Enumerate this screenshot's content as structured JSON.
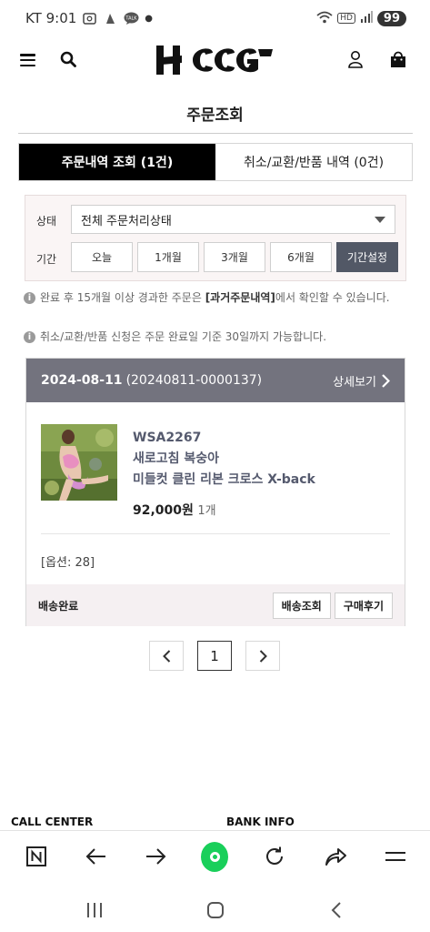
{
  "status_bar": {
    "carrier_time": "KT 9:01",
    "battery": "99",
    "network": "HD"
  },
  "header": {
    "logo_alt": "HOOG"
  },
  "page": {
    "title": "주문조회"
  },
  "tabs": [
    {
      "label": "주문내역 조회 (1건)",
      "active": true
    },
    {
      "label": "취소/교환/반품 내역 (0건)",
      "active": false
    }
  ],
  "filter": {
    "status_label": "상태",
    "status_value": "전체 주문처리상태",
    "period_label": "기간",
    "period_buttons": [
      "오늘",
      "1개월",
      "3개월",
      "6개월",
      "기간설정"
    ]
  },
  "notices": {
    "n1_pre": "완료 후 15개월 이상 경과한 주문은 ",
    "n1_bold": "[과거주문내역]",
    "n1_post": "에서 확인할 수 있습니다.",
    "n2": "취소/교환/반품 신청은 주문 완료일 기준 30일까지 가능합니다."
  },
  "order": {
    "date": "2024-08-11",
    "number": "(20240811-0000137)",
    "detail_label": "상세보기",
    "product_code": "WSA2267",
    "product_name_line1": "새로고침 복숭아",
    "product_name_line2": "미들컷 클린 리본 크로스 X-back",
    "price": "92,000원",
    "quantity": "1개",
    "option": "[옵션: 28]",
    "status": "배송완료",
    "buttons": [
      "배송조회",
      "구매후기"
    ]
  },
  "pagination": {
    "current": "1"
  },
  "footer": {
    "call_center": "CALL CENTER",
    "bank_info": "BANK INFO"
  },
  "colors": {
    "tab_active_bg": "#000000",
    "order_header_bg": "#73737e",
    "period_set_bg": "#525866",
    "browser_home": "#19cf5a"
  }
}
